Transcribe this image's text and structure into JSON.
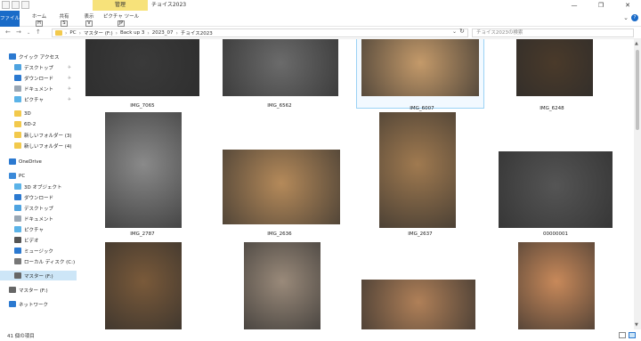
{
  "window": {
    "title": "チョイス2023",
    "contextual_tab": "管理",
    "controls": [
      "—",
      "❐",
      "✕"
    ]
  },
  "ribbon": {
    "tabs": [
      {
        "label": "ファイル",
        "keytip": "F"
      },
      {
        "label": "ホーム",
        "keytip": "H"
      },
      {
        "label": "共有",
        "keytip": "S"
      },
      {
        "label": "表示",
        "keytip": "V"
      },
      {
        "label": "ピクチャ ツール",
        "keytip": "JP"
      }
    ],
    "qat_keytips": [
      "1",
      "2",
      "3"
    ],
    "help": "?"
  },
  "address": {
    "crumbs": [
      "PC",
      "マスター (F:)",
      "Back up 3",
      "2023_07",
      "チョイス2023"
    ],
    "search_placeholder": "チョイス2023の検索"
  },
  "sidebar": {
    "items": [
      {
        "label": "クイック アクセス",
        "color": "#2b79d0",
        "pinned": false
      },
      {
        "label": "デスクトップ",
        "color": "#4ea3e0",
        "pinned": true
      },
      {
        "label": "ダウンロード",
        "color": "#2b79d0",
        "pinned": true
      },
      {
        "label": "ドキュメント",
        "color": "#9aa7b4",
        "pinned": true
      },
      {
        "label": "ピクチャ",
        "color": "#5bb3e8",
        "pinned": true
      },
      {
        "label": "3D",
        "color": "#f2c94c",
        "pinned": false
      },
      {
        "label": "6D-2",
        "color": "#f2c94c",
        "pinned": false
      },
      {
        "label": "新しいフォルダー (3)",
        "color": "#f2c94c",
        "pinned": false
      },
      {
        "label": "新しいフォルダー (4)",
        "color": "#f2c94c",
        "pinned": false
      },
      {
        "label": "OneDrive",
        "color": "#2b79d0",
        "pinned": false
      },
      {
        "label": "PC",
        "color": "#3b8ad9",
        "pinned": false
      },
      {
        "label": "3D オブジェクト",
        "color": "#5bb3e8",
        "pinned": false
      },
      {
        "label": "ダウンロード",
        "color": "#2b79d0",
        "pinned": false
      },
      {
        "label": "デスクトップ",
        "color": "#4ea3e0",
        "pinned": false
      },
      {
        "label": "ドキュメント",
        "color": "#9aa7b4",
        "pinned": false
      },
      {
        "label": "ピクチャ",
        "color": "#5bb3e8",
        "pinned": false
      },
      {
        "label": "ビデオ",
        "color": "#555555",
        "pinned": false
      },
      {
        "label": "ミュージック",
        "color": "#2b79d0",
        "pinned": false
      },
      {
        "label": "ローカル ディスク (C:)",
        "color": "#777777",
        "pinned": false
      },
      {
        "label": "マスター (F:)",
        "color": "#666666",
        "pinned": false
      },
      {
        "label": "マスター (F:)",
        "color": "#666666",
        "pinned": false
      },
      {
        "label": "ネットワーク",
        "color": "#2b79d0",
        "pinned": false
      }
    ]
  },
  "files": [
    {
      "name": "",
      "color": "#3a3a3a"
    },
    {
      "name": "",
      "color": "#6b6b6b"
    },
    {
      "name": "IMG_6007",
      "color": "#c49a6a"
    },
    {
      "name": "IMG_6248",
      "color": "#4a3a2a"
    },
    {
      "name": "IMG_7065",
      "color": "#777777"
    },
    {
      "name": "IMG_6562",
      "color": "#5a5a5a"
    },
    {
      "name": "",
      "color": "#ffffff"
    },
    {
      "name": "",
      "color": "#ffffff"
    },
    {
      "name": "IMG_2787",
      "color": "#8a8a8a"
    },
    {
      "name": "IMG_2636",
      "color": "#b58a5a"
    },
    {
      "name": "IMG_2637",
      "color": "#a07a50"
    },
    {
      "name": "00000001",
      "color": "#555555"
    },
    {
      "name": "",
      "color": "#7a5a3a"
    },
    {
      "name": "",
      "color": "#9a8a7a"
    },
    {
      "name": "",
      "color": "#b08058"
    },
    {
      "name": "",
      "color": "#c8895a"
    }
  ],
  "status": {
    "count": "41 個の項目",
    "controls": {
      "details_view": "詳細",
      "thumb_view": "大アイコン"
    }
  }
}
